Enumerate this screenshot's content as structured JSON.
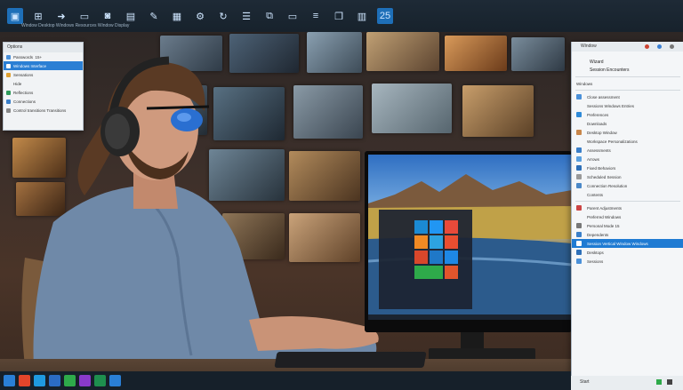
{
  "menu": {
    "header": "Options",
    "items": [
      {
        "label": "Passwords",
        "suffix": "15+"
      },
      {
        "label": "Windows Interface",
        "suffix": ""
      },
      {
        "label": "Sensations",
        "suffix": ""
      },
      {
        "label": "Hide",
        "suffix": ""
      },
      {
        "label": "Reflections",
        "suffix": ""
      },
      {
        "label": "Connections",
        "suffix": ""
      },
      {
        "label": "Control transitions Transitions",
        "suffix": ""
      }
    ]
  },
  "rpanel": {
    "header": "Window",
    "title": "Wizard",
    "subtitle": "Session  Encounters",
    "section": "Windows",
    "items": [
      {
        "label": "Close  assessment"
      },
      {
        "label": "Sessions Windows Entries"
      },
      {
        "label": "Preferences"
      },
      {
        "label": "Downloads"
      },
      {
        "label": "Desktop  Window"
      },
      {
        "label": "Workspace Personalizations"
      },
      {
        "label": "Assessments"
      },
      {
        "label": "Arrows"
      },
      {
        "label": "Fixed Behaviors"
      },
      {
        "label": "Scheduled Session"
      },
      {
        "label": "Connection  Resolution"
      },
      {
        "label": "Contents"
      },
      {
        "label": "Parent  Adjustments"
      },
      {
        "label": "Preferred Windows"
      },
      {
        "label": "Personal Mode 15"
      },
      {
        "label": "Dependents"
      },
      {
        "label": "Session Vertical Window Windows"
      },
      {
        "label": "Desktops"
      },
      {
        "label": "Sessions"
      }
    ],
    "footer": "Start"
  },
  "toolbar": {
    "path": "Window  Desktop Windows  Resources  Window Display"
  },
  "colors": {
    "accent": "#1f7bd3",
    "toolbar": "#17222c",
    "panel": "#f4f6f8"
  }
}
